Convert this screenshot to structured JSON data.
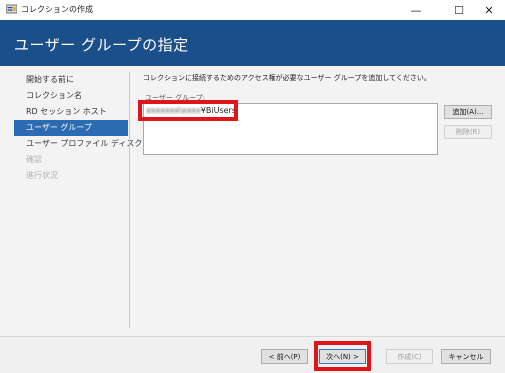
{
  "window": {
    "title": "コレクションの作成",
    "controls": {
      "minimize": "—",
      "maximize": "☐",
      "close": "✕"
    }
  },
  "page_title": "ユーザー グループの指定",
  "nav": {
    "items": [
      {
        "label": "開始する前に",
        "state": "normal"
      },
      {
        "label": "コレクション名",
        "state": "normal"
      },
      {
        "label": "RD セッション ホスト",
        "state": "normal"
      },
      {
        "label": "ユーザー グループ",
        "state": "active"
      },
      {
        "label": "ユーザー プロファイル ディスク",
        "state": "normal"
      },
      {
        "label": "確認",
        "state": "disabled"
      },
      {
        "label": "進行状況",
        "state": "disabled"
      }
    ]
  },
  "main": {
    "instruction": "コレクションに接続するためのアクセス権が必要なユーザー グループを追加してください。",
    "list_label": "ユーザー グループ:",
    "list_entries": [
      {
        "prefix_redacted": "xxxxxxx\\xxxx",
        "suffix": "¥BiUsers"
      }
    ],
    "add_button": "追加(A)...",
    "remove_button": "削除(R)"
  },
  "footer": {
    "back_button": "< 前へ(P)",
    "next_button": "次へ(N) >",
    "create_button": "作成(C)",
    "cancel_button": "キャンセル"
  },
  "colors": {
    "header_band": "#1b4f8a",
    "nav_active": "#2b6bb2",
    "highlight": "#e0141b"
  }
}
